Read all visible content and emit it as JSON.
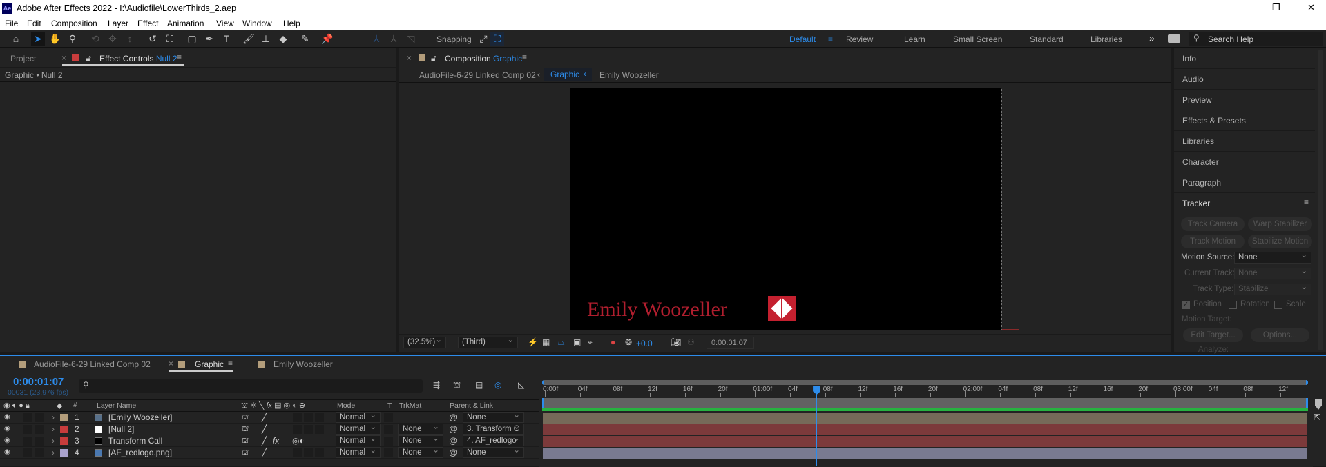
{
  "app": {
    "icon": "Ae",
    "title": "Adobe After Effects 2022 - I:\\Audiofile\\LowerThirds_2.aep"
  },
  "window_controls": {
    "minimize": "—",
    "maximize": "❐",
    "close": "✕"
  },
  "menu": [
    "File",
    "Edit",
    "Composition",
    "Layer",
    "Effect",
    "Animation",
    "View",
    "Window",
    "Help"
  ],
  "toolbar": {
    "snapping": "Snapping"
  },
  "workspaces": {
    "items": [
      "Default",
      "Review",
      "Learn",
      "Small Screen",
      "Standard",
      "Libraries"
    ],
    "active": "Default",
    "more": "»",
    "search_placeholder": "Search Help"
  },
  "left_panel": {
    "tab_project": "Project",
    "tab_effect_controls": "Effect Controls",
    "effect_target": "Null 2",
    "breadcrumb": "Graphic • Null 2"
  },
  "comp_panel": {
    "tab_label": "Composition",
    "comp_name": "Graphic",
    "breadcrumbs": [
      "AudioFile-6-29 Linked Comp 02",
      "Graphic",
      "Emily Woozeller"
    ],
    "preview_text": "Emily Woozeller",
    "zoom": "(32.5%)",
    "resolution": "(Third)",
    "exposure": "+0.0",
    "timecode": "0:00:01:07"
  },
  "right_panel": {
    "items": [
      "Info",
      "Audio",
      "Preview",
      "Effects & Presets",
      "Libraries",
      "Character",
      "Paragraph"
    ],
    "tracker": {
      "title": "Tracker",
      "track_camera": "Track Camera",
      "warp_stabilizer": "Warp Stabilizer",
      "track_motion": "Track Motion",
      "stabilize_motion": "Stabilize Motion",
      "motion_source_label": "Motion Source:",
      "motion_source": "None",
      "current_track_label": "Current Track:",
      "current_track": "None",
      "track_type_label": "Track Type:",
      "track_type": "Stabilize",
      "position": "Position",
      "position_checked": true,
      "rotation": "Rotation",
      "scale": "Scale",
      "motion_target": "Motion Target:",
      "edit_target": "Edit Target...",
      "options": "Options...",
      "analyze": "Analyze:"
    }
  },
  "timeline": {
    "tabs": [
      {
        "label": "AudioFile-6-29 Linked Comp 02",
        "color": "#b39d7b"
      },
      {
        "label": "Graphic",
        "color": "#b39d7b"
      },
      {
        "label": "Emily Woozeller",
        "color": "#b39d7b"
      }
    ],
    "timecode": "0:00:01:07",
    "frame_info": "00031 (23.976 fps)",
    "columns": {
      "num": "#",
      "layer_name": "Layer Name",
      "mode": "Mode",
      "t": "T",
      "trkmat": "TrkMat",
      "parent": "Parent & Link"
    },
    "layers": [
      {
        "num": "1",
        "name": "[Emily Woozeller]",
        "color": "#b39d7b",
        "mode": "Normal",
        "trkmat": "",
        "parent": "None",
        "fx": "",
        "bar": "#766a59"
      },
      {
        "num": "2",
        "name": "[Null 2]",
        "color": "#c83c3c",
        "mode": "Normal",
        "trkmat": "None",
        "parent": "3. Transform C",
        "fx": "",
        "bar": "#7c3a3b"
      },
      {
        "num": "3",
        "name": "Transform Call",
        "color": "#c83c3c",
        "mode": "Normal",
        "trkmat": "None",
        "parent": "4. AF_redlogo",
        "fx": "fx",
        "bar": "#7c3a3b"
      },
      {
        "num": "4",
        "name": "[AF_redlogo.png]",
        "color": "#a9a2cc",
        "mode": "Normal",
        "trkmat": "None",
        "parent": "None",
        "fx": "",
        "bar": "#797a90"
      }
    ],
    "ruler": {
      "labels": [
        "0:00f",
        "04f",
        "08f",
        "12f",
        "16f",
        "20f",
        "01:00f",
        "04f",
        "08f",
        "12f",
        "16f",
        "20f",
        "02:00f",
        "04f",
        "08f",
        "12f",
        "16f",
        "20f",
        "03:00f",
        "04f",
        "08f",
        "12f"
      ],
      "frame_step": 4,
      "current_frame": 31
    }
  }
}
